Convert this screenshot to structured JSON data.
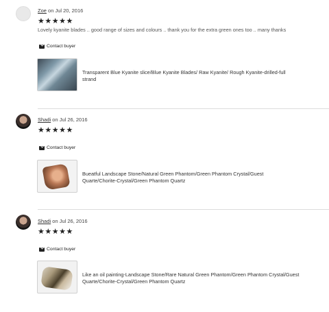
{
  "reviews": [
    {
      "username": "Zoe",
      "date_text": "on Jul 20, 2016",
      "stars": "★★★★★",
      "review_text": "Lovely kyanite blades .. good range of sizes and colours .. thank you for the extra green ones too .. many thanks",
      "contact_label": "Contact buyer",
      "listing_title_line1": "Transparent Blue Kyanite slice/Blue Kyanite Blades/ Raw Kyanite/ Rough Kyanite-drilled-full",
      "listing_title_line2": "strand"
    },
    {
      "username": "Shadi",
      "date_text": "on Jul 26, 2016",
      "stars": "★★★★★",
      "review_text": "",
      "contact_label": "Contact buyer",
      "listing_title_line1": "Bueatful Landscape Stone/Natural Green Phantom/Green Phantom Crystal/Guest",
      "listing_title_line2": "Quarte/Chorite-Crystal/Green Phantom Quartz"
    },
    {
      "username": "Shadi",
      "date_text": "on Jul 26, 2016",
      "stars": "★★★★★",
      "review_text": "",
      "contact_label": "Contact buyer",
      "listing_title_line1": "Like an oil painting-Landscape Stone/Rare Natural Green Phantom/Green Phantom Crystal/Guest",
      "listing_title_line2": "Quarte/Chorite-Crystal/Green Phantom Quartz"
    }
  ]
}
